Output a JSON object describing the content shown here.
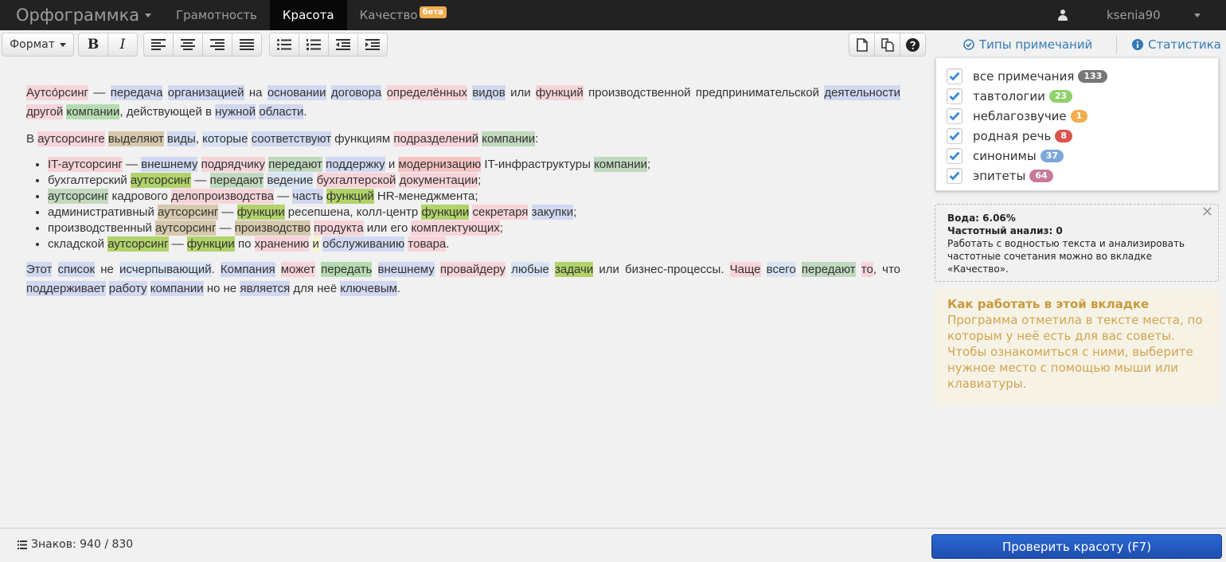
{
  "navbar": {
    "brand": "Орфограммка",
    "tabs": [
      {
        "label": "Грамотность",
        "active": false
      },
      {
        "label": "Красота",
        "active": true
      },
      {
        "label": "Качество",
        "active": false,
        "badge": "бета"
      }
    ],
    "user": {
      "name": "ksenia90",
      "icon": "user-icon"
    }
  },
  "toolbar": {
    "format_label": "Формат",
    "buttons": [
      "bold",
      "italic",
      "align-left",
      "align-center",
      "align-right",
      "align-justify",
      "bullet-list",
      "numbered-list",
      "outdent",
      "indent",
      "new-document",
      "copy",
      "help"
    ],
    "bold_glyph": "B",
    "italic_glyph": "I"
  },
  "right_tabs": {
    "notes_types": "Типы примечаний",
    "statistics": "Статистика"
  },
  "notes": [
    {
      "label": "все примечания",
      "count": "133",
      "color": "#777777",
      "checked": true
    },
    {
      "label": "тавтологии",
      "count": "23",
      "color": "#8fd16a",
      "checked": true
    },
    {
      "label": "неблагозвучие",
      "count": "1",
      "color": "#f0ad4e",
      "checked": true
    },
    {
      "label": "родная речь",
      "count": "8",
      "color": "#d9534f",
      "checked": true
    },
    {
      "label": "синонимы",
      "count": "37",
      "color": "#7ea7dd",
      "checked": true
    },
    {
      "label": "эпитеты",
      "count": "64",
      "color": "#c97a99",
      "checked": true
    }
  ],
  "info": {
    "water": "Вода: 6.06%",
    "freq": "Частотный анализ: 0",
    "text": "Работать с водностью текста и анализировать частотные сочетания можно во вкладке «Качество»."
  },
  "help": {
    "title": "Как работать в этой вкладке",
    "text": "Программа отметила в тексте места, по которым у неё есть для вас советы. Чтобы ознакомиться с ними, выберите нужное место с помощью мыши или клавиатуры."
  },
  "footer": {
    "count": "Знаков: 940 / 830",
    "check_button": "Проверить красоту (F7)"
  },
  "editor": {
    "paragraphs": [
      [
        [
          "Аутсо́рсинг",
          "r"
        ],
        [
          " — ",
          ""
        ],
        [
          "передача",
          "b"
        ],
        [
          " ",
          ""
        ],
        [
          "организацией",
          "b"
        ],
        [
          " на ",
          ""
        ],
        [
          "основании",
          "b"
        ],
        [
          " ",
          ""
        ],
        [
          "договора",
          "b"
        ],
        [
          " ",
          ""
        ],
        [
          "определённых",
          "r"
        ],
        [
          " ",
          ""
        ],
        [
          "видов",
          "b"
        ],
        [
          " или ",
          ""
        ],
        [
          "функций",
          "r"
        ],
        [
          " производственной предпринимательской ",
          ""
        ],
        [
          "деятельности",
          "b"
        ],
        [
          " ",
          ""
        ],
        [
          "другой",
          "r"
        ],
        [
          " ",
          ""
        ],
        [
          "компании",
          "g"
        ],
        [
          ", действующей в ",
          ""
        ],
        [
          "нужной",
          "b"
        ],
        [
          " ",
          ""
        ],
        [
          "области",
          "b"
        ],
        [
          ".",
          ""
        ]
      ],
      [
        [
          "В ",
          ""
        ],
        [
          "аутсорсинге",
          "r"
        ],
        [
          " ",
          ""
        ],
        [
          "выделяют",
          "tn"
        ],
        [
          " ",
          ""
        ],
        [
          "виды",
          "b"
        ],
        [
          ", ",
          ""
        ],
        [
          "которые",
          "lb"
        ],
        [
          " ",
          ""
        ],
        [
          "соответствуют",
          "b"
        ],
        [
          " функциям ",
          ""
        ],
        [
          "подразделений",
          "r"
        ],
        [
          " ",
          ""
        ],
        [
          "компании",
          "gg"
        ],
        [
          ":",
          ""
        ]
      ]
    ],
    "list": [
      [
        [
          "IT-аутсорсинг",
          "r"
        ],
        [
          " — ",
          ""
        ],
        [
          "внешнему",
          "b"
        ],
        [
          " ",
          ""
        ],
        [
          "подрядчику",
          "r"
        ],
        [
          " ",
          ""
        ],
        [
          "передают",
          "gg"
        ],
        [
          " ",
          ""
        ],
        [
          "поддержку",
          "b"
        ],
        [
          " и ",
          ""
        ],
        [
          "модернизацию",
          "o"
        ],
        [
          " IT-инфраструктуры ",
          ""
        ],
        [
          "компании",
          "gg"
        ],
        [
          ";",
          ""
        ]
      ],
      [
        [
          "бухгалтерский ",
          ""
        ],
        [
          "аутсорсинг",
          "gr"
        ],
        [
          " — ",
          ""
        ],
        [
          "передают",
          "gg"
        ],
        [
          " ",
          ""
        ],
        [
          "ведение",
          "lb"
        ],
        [
          " ",
          ""
        ],
        [
          "бухгалтерской",
          "r"
        ],
        [
          " ",
          ""
        ],
        [
          "документации",
          "r"
        ],
        [
          ";",
          ""
        ]
      ],
      [
        [
          "аутсорсинг",
          "gg"
        ],
        [
          " кадрового ",
          ""
        ],
        [
          "делопроизводства",
          "r"
        ],
        [
          " — ",
          ""
        ],
        [
          "часть",
          "b"
        ],
        [
          " ",
          ""
        ],
        [
          "функций",
          "gr"
        ],
        [
          " HR-менеджмента;",
          ""
        ]
      ],
      [
        [
          "административный ",
          ""
        ],
        [
          "аутсорсинг",
          "tn"
        ],
        [
          " — ",
          ""
        ],
        [
          "функции",
          "gr"
        ],
        [
          " ресепшена, колл-центр ",
          ""
        ],
        [
          "функции",
          "gr"
        ],
        [
          " ",
          ""
        ],
        [
          "секретаря",
          "r"
        ],
        [
          " ",
          ""
        ],
        [
          "закупки",
          "b"
        ],
        [
          ";",
          ""
        ]
      ],
      [
        [
          "производственный ",
          ""
        ],
        [
          "аутсорсинг",
          "tn"
        ],
        [
          " — ",
          ""
        ],
        [
          "производство",
          "tn"
        ],
        [
          " ",
          ""
        ],
        [
          "продукта",
          "r"
        ],
        [
          " или его ",
          ""
        ],
        [
          "комплектующих",
          "r"
        ],
        [
          ";",
          ""
        ]
      ],
      [
        [
          "складской ",
          ""
        ],
        [
          "аутсорсинг",
          "gr"
        ],
        [
          " — ",
          ""
        ],
        [
          "функции",
          "gr"
        ],
        [
          " по ",
          ""
        ],
        [
          "хранению",
          "r"
        ],
        [
          " ",
          ""
        ],
        [
          "и",
          "y"
        ],
        [
          " ",
          ""
        ],
        [
          "обслуживанию",
          "b"
        ],
        [
          " ",
          ""
        ],
        [
          "товара",
          "r"
        ],
        [
          ".",
          ""
        ]
      ]
    ],
    "last": [
      [
        "Этот",
        "b"
      ],
      [
        " ",
        ""
      ],
      [
        "список",
        "b"
      ],
      [
        " не ",
        ""
      ],
      [
        "исчерпывающий",
        "lb"
      ],
      [
        ". ",
        ""
      ],
      [
        "Компания",
        "b"
      ],
      [
        " ",
        ""
      ],
      [
        "может",
        "r"
      ],
      [
        " ",
        ""
      ],
      [
        "передать",
        "g"
      ],
      [
        " ",
        ""
      ],
      [
        "внешнему",
        "b"
      ],
      [
        " ",
        ""
      ],
      [
        "провайдеру",
        "r"
      ],
      [
        " ",
        ""
      ],
      [
        "любые",
        "lb"
      ],
      [
        " ",
        ""
      ],
      [
        "задачи",
        "gr"
      ],
      [
        " или бизнес-процессы. ",
        ""
      ],
      [
        "Чаще",
        "r"
      ],
      [
        " ",
        ""
      ],
      [
        "всего",
        "lb"
      ],
      [
        " ",
        ""
      ],
      [
        "передают",
        "gg"
      ],
      [
        " ",
        ""
      ],
      [
        "то",
        "r"
      ],
      [
        ", что ",
        ""
      ],
      [
        "поддерживает",
        "b"
      ],
      [
        " ",
        ""
      ],
      [
        "работу",
        "b"
      ],
      [
        " ",
        ""
      ],
      [
        "компании",
        "b"
      ],
      [
        " но не ",
        ""
      ],
      [
        "является",
        "b"
      ],
      [
        " для неё ",
        ""
      ],
      [
        "ключевым",
        "b"
      ],
      [
        ".",
        ""
      ]
    ]
  }
}
